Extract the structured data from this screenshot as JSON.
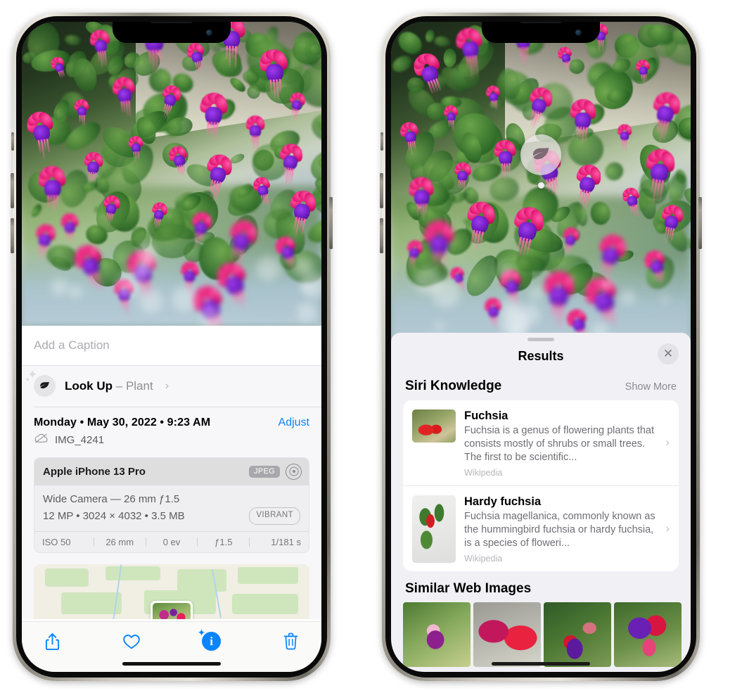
{
  "left_phone": {
    "caption": {
      "placeholder": "Add a Caption",
      "value": ""
    },
    "lookup": {
      "icon": "leaf-icon",
      "label": "Look Up",
      "separator": "–",
      "subject": "Plant",
      "chevron": "›"
    },
    "date_line": "Monday • May 30, 2022 • 9:23 AM",
    "adjust_label": "Adjust",
    "filename": "IMG_4241",
    "cloud_icon": "icloud-slash-icon",
    "metadata": {
      "device": "Apple iPhone 13 Pro",
      "format_badge": "JPEG",
      "lens_icon": "aperture-ring-icon",
      "lens_line": "Wide Camera — 26 mm ƒ1.5",
      "specs_line": "12 MP • 3024 × 4032 • 3.5 MB",
      "style_badge": "VIBRANT",
      "exif": [
        "ISO 50",
        "26 mm",
        "0 ev",
        "ƒ1.5",
        "1/181 s"
      ]
    },
    "toolbar": [
      {
        "name": "share-button",
        "icon": "share-icon"
      },
      {
        "name": "favorite-button",
        "icon": "heart-icon"
      },
      {
        "name": "info-button",
        "icon": "info-sparkle-icon",
        "glyph": "i"
      },
      {
        "name": "delete-button",
        "icon": "trash-icon"
      }
    ]
  },
  "right_phone": {
    "marker": {
      "icon": "leaf-icon"
    },
    "sheet": {
      "title": "Results",
      "close_label": "✕",
      "sections": [
        {
          "title": "Siri Knowledge",
          "action": "Show More",
          "items": [
            {
              "title": "Fuchsia",
              "description": "Fuchsia is a genus of flowering plants that consists mostly of shrubs or small trees. The first to be scientific...",
              "source": "Wikipedia",
              "chevron": "›"
            },
            {
              "title": "Hardy fuchsia",
              "description": "Fuchsia magellanica, commonly known as the hummingbird fuchsia or hardy fuchsia, is a species of floweri...",
              "source": "Wikipedia",
              "chevron": "›"
            }
          ]
        },
        {
          "title": "Similar Web Images",
          "images": [
            "fuchsia-web-image-1",
            "fuchsia-web-image-2",
            "fuchsia-web-image-3",
            "fuchsia-web-image-4"
          ]
        }
      ]
    }
  },
  "colors": {
    "accent_blue": "#0a84ff",
    "sheet_bg": "#f1f0f5",
    "panel_bg": "#f7f7f9",
    "card_bg": "#ffffff",
    "secondary_text": "#8e8e93"
  }
}
